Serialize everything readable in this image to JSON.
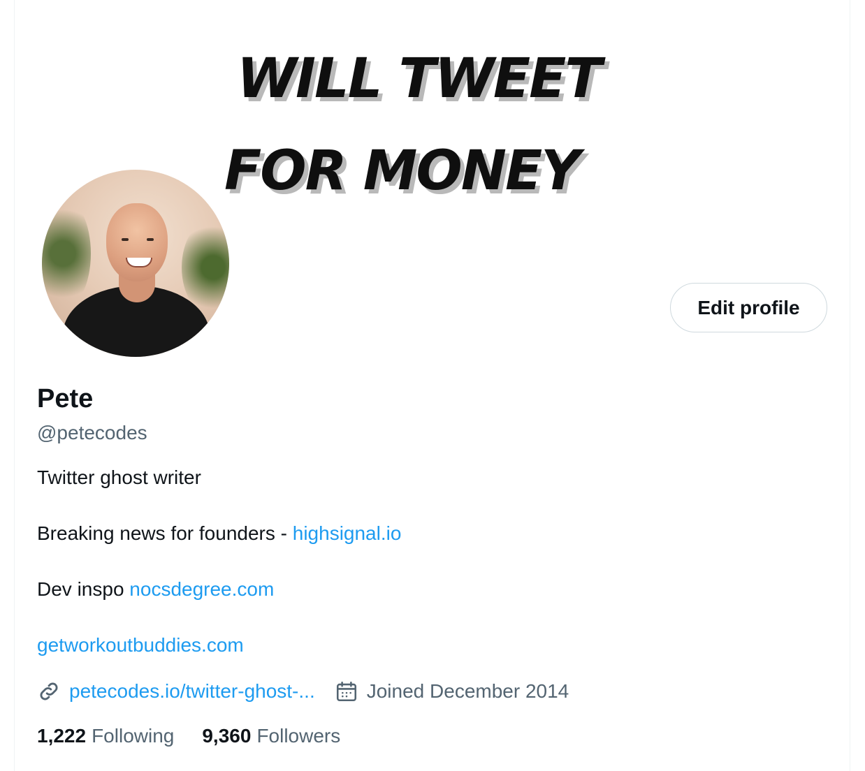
{
  "banner": {
    "line1": "WILL TWEET",
    "line2": "FOR MONEY"
  },
  "profile": {
    "name": "Pete",
    "handle": "@petecodes",
    "edit_label": "Edit profile",
    "bio": {
      "line1": "Twitter ghost writer",
      "line2_text": "Breaking news for founders - ",
      "line2_link": "highsignal.io",
      "line3_text": "Dev inspo ",
      "line3_link": "nocsdegree.com",
      "line4_link": "getworkoutbuddies.com"
    },
    "website": "petecodes.io/twitter-ghost-...",
    "joined": "Joined December 2014"
  },
  "stats": {
    "following_count": "1,222",
    "following_label": "Following",
    "followers_count": "9,360",
    "followers_label": "Followers"
  },
  "icons": {
    "link": "link-icon",
    "calendar": "calendar-icon"
  },
  "colors": {
    "link": "#1d9bf0",
    "secondary_text": "#536471",
    "primary_text": "#0f1419"
  }
}
